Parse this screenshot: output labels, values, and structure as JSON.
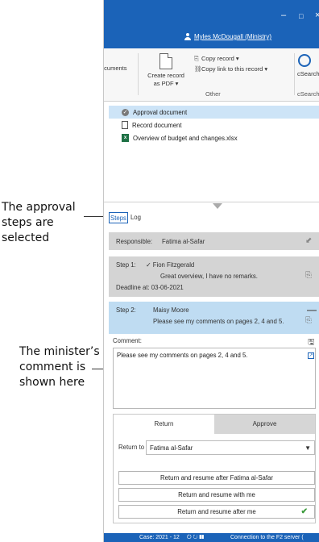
{
  "annotations": {
    "steps_note": "The approval steps are selected",
    "comment_note": "The minister’s comment is shown here"
  },
  "window": {
    "minimize_glyph": "–",
    "maximize_glyph": "□",
    "close_glyph": "×",
    "user_name": "Myles McDougall (Ministry)"
  },
  "ribbon": {
    "documents_label": "ocuments",
    "create_pdf_label": "Create record as PDF ▾",
    "copy_record_label": "Copy record ▾",
    "copy_link_label": "Copy link to this record ▾",
    "group_other": "Other",
    "csearch_label": "cSearch",
    "group_csearch": "cSearch"
  },
  "documents": [
    {
      "name": "Approval document",
      "icon": "check-circle-icon"
    },
    {
      "name": "Record document",
      "icon": "document-icon"
    },
    {
      "name": "Overview of budget and changes.xlsx",
      "icon": "excel-icon"
    }
  ],
  "tabs": {
    "steps": "Steps",
    "log": "Log"
  },
  "responsible": {
    "label": "Responsible:",
    "value": "Fatima al-Safar"
  },
  "step1": {
    "label": "Step 1:",
    "name": "Fion Fitzgerald",
    "text": "Great overview, I have no remarks.",
    "deadline": "Deadline at: 03-06-2021"
  },
  "step2": {
    "label": "Step 2:",
    "name": "Maisy Moore",
    "text": "Please see my comments on pages 2, 4 and 5."
  },
  "comment": {
    "label": "Comment:",
    "value": "Please see my comments on pages 2, 4 and 5."
  },
  "action": {
    "return_tab": "Return",
    "approve_tab": "Approve",
    "return_to_label": "Return to",
    "return_to_value": "Fatima al-Safar",
    "options": [
      "Return and resume after Fatima al-Safar",
      "Return and resume with me",
      "Return and resume after me"
    ]
  },
  "statusbar": {
    "case": "Case: 2021 - 12",
    "connection": "Connection to the F2 server ("
  },
  "colors": {
    "accent": "#1b63b8",
    "selected_row": "#cde4f7",
    "active_step": "#bfdcf2",
    "inactive_step": "#d4d4d4",
    "confirm_tick": "#3a9a3a"
  }
}
